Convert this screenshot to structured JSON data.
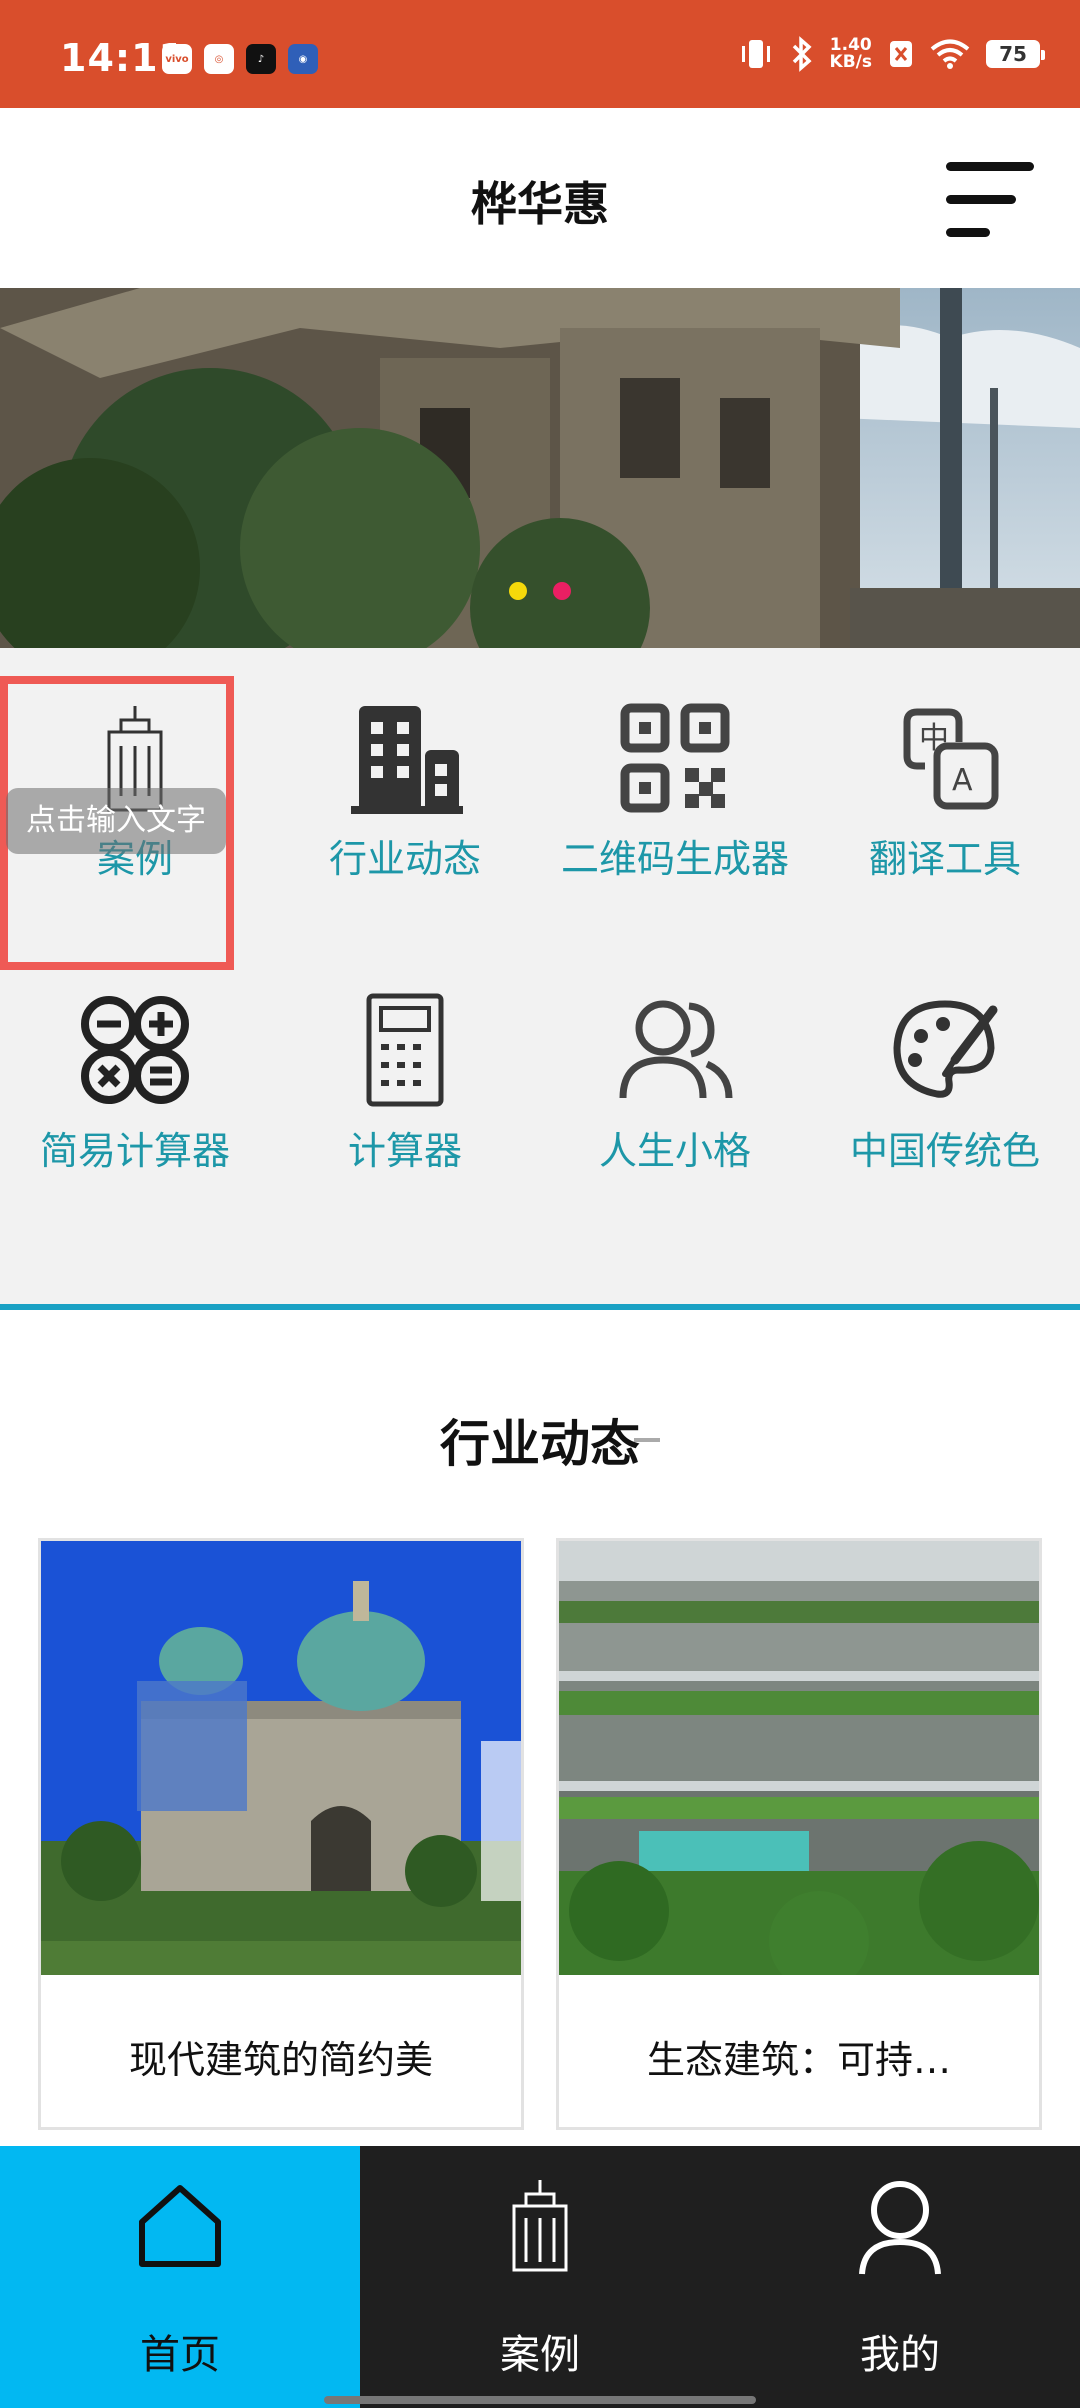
{
  "status_bar": {
    "time": "14:11",
    "app_icons": [
      "vivo",
      "bubble",
      "tiktok",
      "puppy"
    ],
    "net_speed_top": "1.40",
    "net_speed_bottom": "KB/s",
    "battery": "75"
  },
  "header": {
    "title": "桦华惠"
  },
  "banner": {
    "slide_count": 2,
    "active_dot_color": "#f5d90a",
    "dot_color": "#ea1f63"
  },
  "grid": {
    "items": [
      {
        "label": "案例",
        "icon": "building-outline-icon"
      },
      {
        "label": "行业动态",
        "icon": "buildings-icon"
      },
      {
        "label": "二维码生成器",
        "icon": "qr-code-icon"
      },
      {
        "label": "翻译工具",
        "icon": "translate-icon"
      },
      {
        "label": "简易计算器",
        "icon": "calculator-circles-icon"
      },
      {
        "label": "计算器",
        "icon": "calculator-icon"
      },
      {
        "label": "人生小格",
        "icon": "people-icon"
      },
      {
        "label": "中国传统色",
        "icon": "palette-icon"
      }
    ],
    "tooltip": "点击输入文字"
  },
  "news": {
    "title": "行业动态",
    "cards": [
      {
        "caption": "现代建筑的简约美"
      },
      {
        "caption": "生态建筑：可持…"
      }
    ]
  },
  "tabbar": {
    "tabs": [
      {
        "label": "首页",
        "icon": "home-icon"
      },
      {
        "label": "案例",
        "icon": "building-icon"
      },
      {
        "label": "我的",
        "icon": "user-icon"
      }
    ]
  },
  "colors": {
    "status_bar": "#d94e2c",
    "accent_teal": "#1d97a8",
    "tab_active": "#02b8f2",
    "highlight_box": "#ef5a55"
  }
}
